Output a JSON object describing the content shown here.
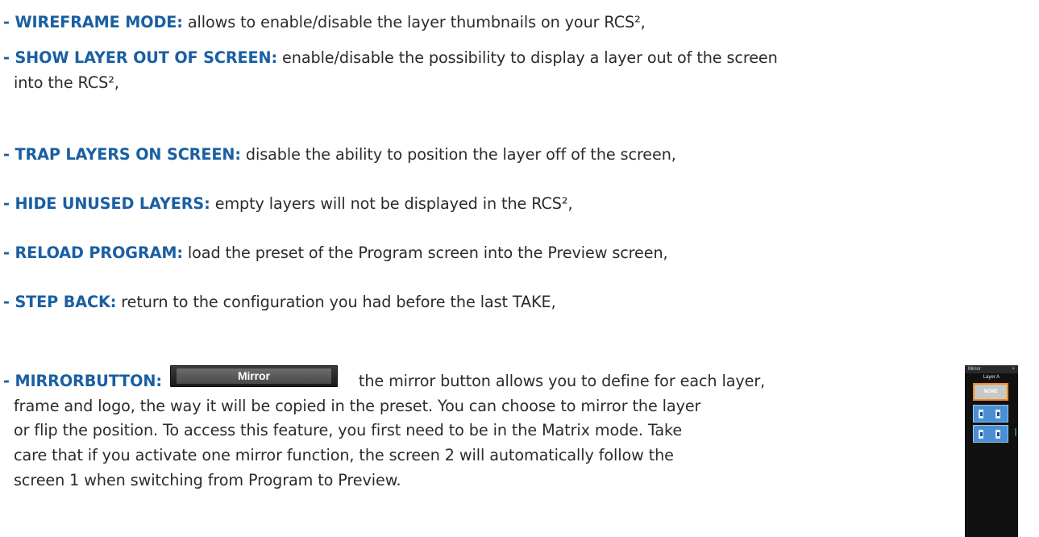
{
  "items": [
    {
      "dash": "- ",
      "term": "WIREFRAME MODE:",
      "desc": " allows to enable/disable the layer thumbnails on your RCS²,",
      "cont": ""
    },
    {
      "dash": "- ",
      "term": "SHOW LAYER OUT OF SCREEN:",
      "desc": " enable/disable the possibility to display a layer out of the screen",
      "cont": "into the RCS²,"
    },
    {
      "dash": "- ",
      "term": "TRAP LAYERS ON SCREEN:",
      "desc": " disable the ability to position the layer off of the screen,",
      "cont": ""
    },
    {
      "dash": "- ",
      "term": "HIDE UNUSED LAYERS:",
      "desc": " empty layers will not be displayed in the RCS²,",
      "cont": ""
    },
    {
      "dash": "- ",
      "term": "RELOAD PROGRAM:",
      "desc": " load the preset of the Program screen into the Preview screen,",
      "cont": ""
    },
    {
      "dash": "- ",
      "term": "STEP BACK:",
      "desc": " return to the configuration you had before the last TAKE,",
      "cont": ""
    }
  ],
  "mirror": {
    "dash": "- ",
    "term": "MIRRORBUTTON:",
    "button_label": "Mirror",
    "line1_rest": "the mirror button allows you to define for each layer,",
    "lines": [
      "frame and logo, the way it will be copied in the preset. You can choose to mirror the layer",
      "or flip the position. To access this feature, you first need to be in the Matrix mode. Take",
      "care that if you activate one mirror function, the screen 2 will automatically follow the",
      "screen 1 when switching from Program to Preview."
    ]
  },
  "panel": {
    "title": "Mirror",
    "close": "×",
    "layer_label": "Layer A",
    "none_label": "NONE",
    "accent": "#f28a1b",
    "button_color": "#4a8fd6"
  },
  "colors": {
    "term": "#1a5fa2",
    "text": "#2b2b2b"
  }
}
